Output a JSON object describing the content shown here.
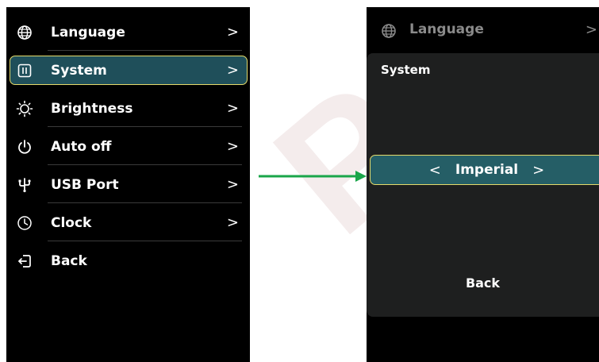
{
  "watermark": "PS",
  "left_menu": {
    "items": [
      {
        "label": "Language",
        "chevron": ">"
      },
      {
        "label": "System",
        "chevron": ">"
      },
      {
        "label": "Brightness",
        "chevron": ">"
      },
      {
        "label": "Auto off",
        "chevron": ">"
      },
      {
        "label": "USB Port",
        "chevron": ">"
      },
      {
        "label": "Clock",
        "chevron": ">"
      },
      {
        "label": "Back"
      }
    ]
  },
  "right_screen": {
    "language_label": "Language",
    "language_chevron": ">",
    "popup": {
      "title": "System",
      "prev": "<",
      "value": "Imperial",
      "next": ">",
      "back_label": "Back"
    }
  },
  "colors": {
    "selection_fill": "#1f4f5a",
    "selection_border": "#e4da6a",
    "arrow": "#1aa64a"
  },
  "icons": [
    "globe-icon",
    "system-icon",
    "brightness-icon",
    "power-icon",
    "usb-icon",
    "clock-icon",
    "back-icon"
  ]
}
